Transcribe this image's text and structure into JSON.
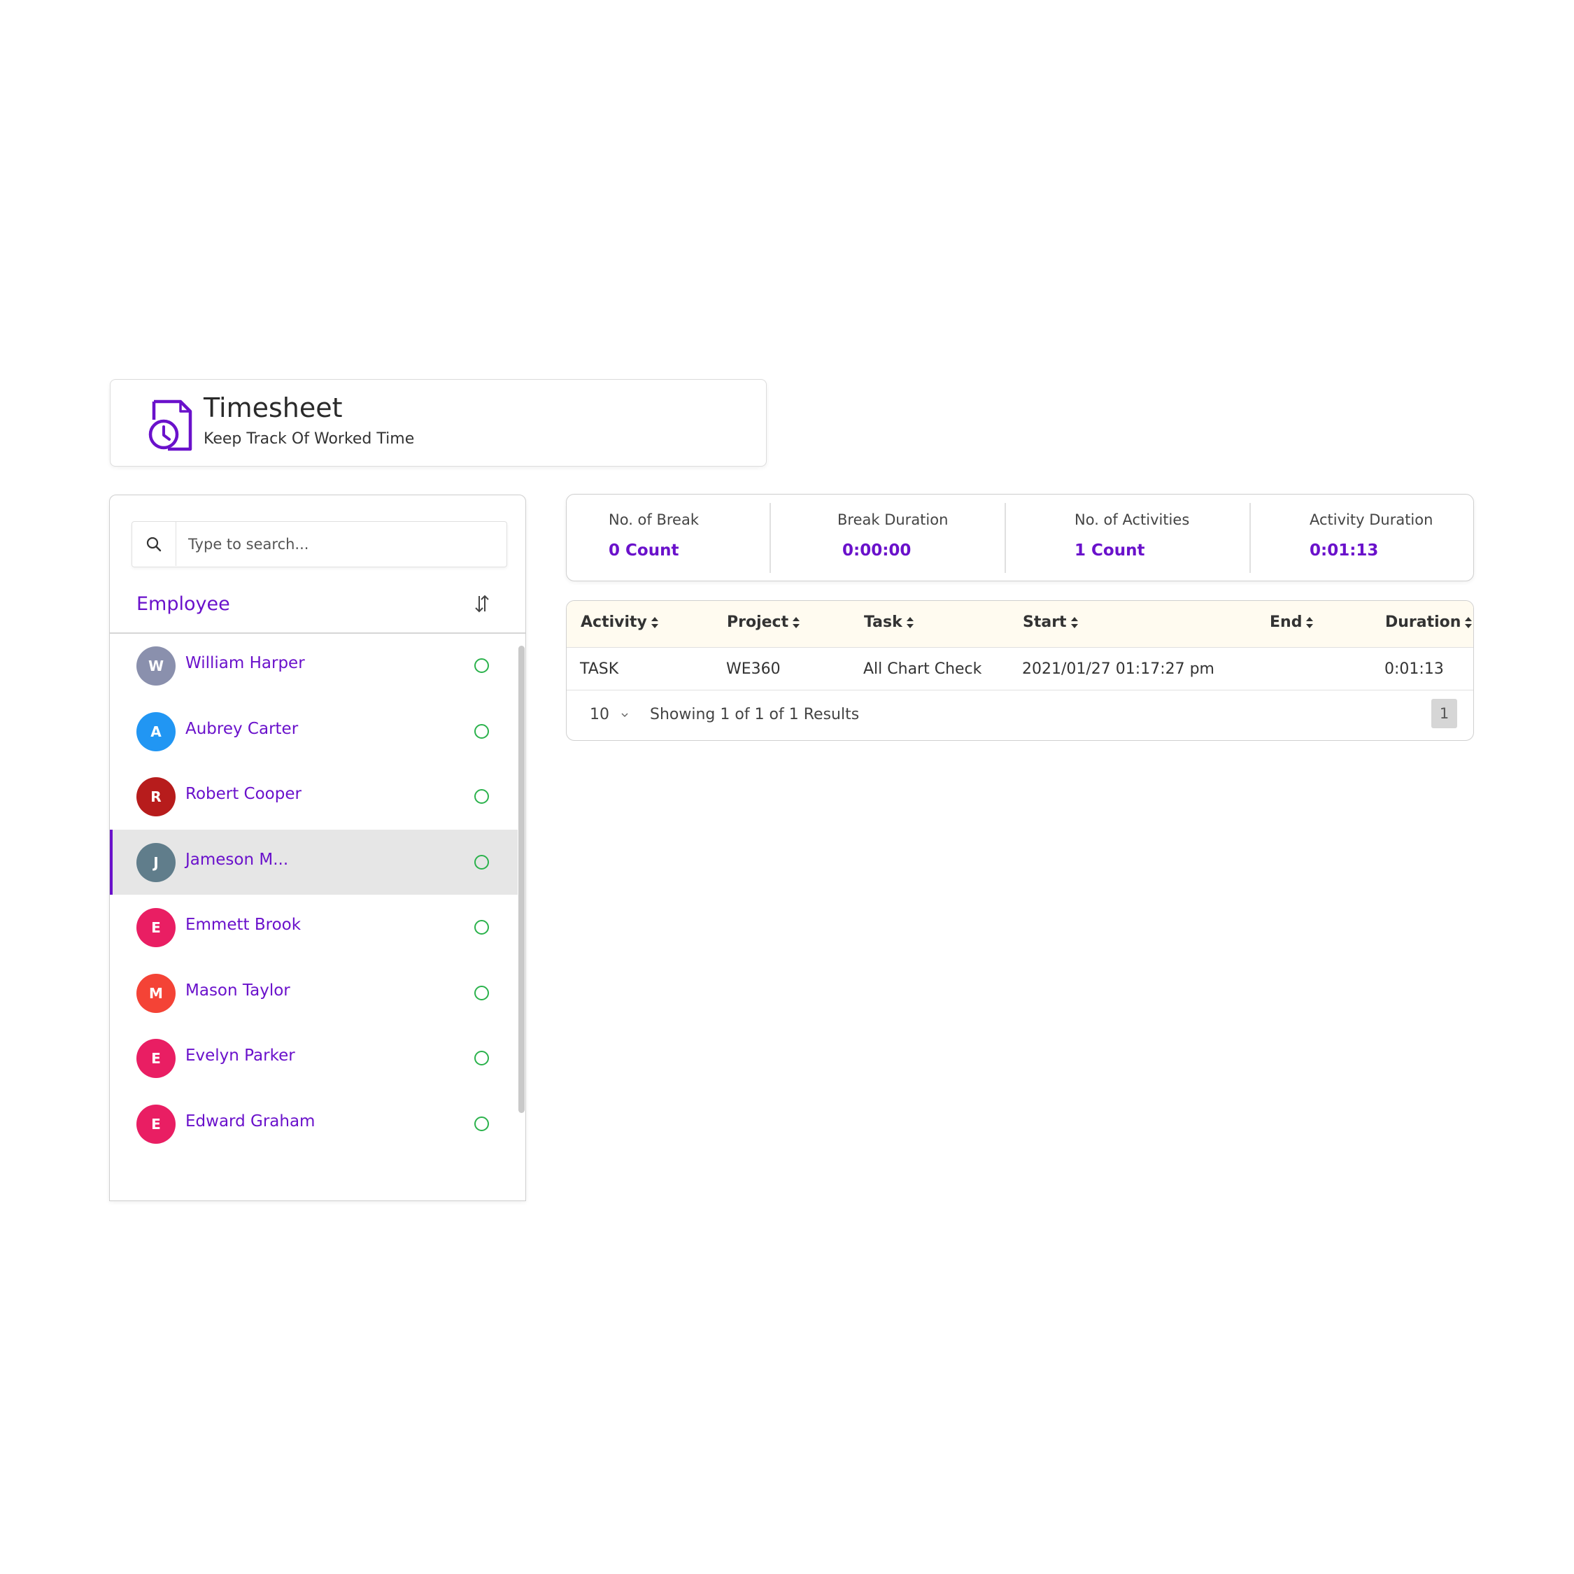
{
  "header": {
    "title": "Timesheet",
    "subtitle": "Keep Track Of Worked Time",
    "icon": "timesheet-clock-icon",
    "accent_color": "#6a11cb"
  },
  "sidebar": {
    "search": {
      "placeholder": "Type to search...",
      "value": ""
    },
    "heading": "Employee",
    "employees": [
      {
        "initial": "W",
        "name": "William Harper",
        "avatar_color": "#8a90ad",
        "status": "online",
        "selected": false
      },
      {
        "initial": "A",
        "name": "Aubrey Carter",
        "avatar_color": "#2196f3",
        "status": "online",
        "selected": false
      },
      {
        "initial": "R",
        "name": "Robert Cooper",
        "avatar_color": "#b71c1c",
        "status": "online",
        "selected": false
      },
      {
        "initial": "J",
        "name": "Jameson M...",
        "avatar_color": "#607d8b",
        "status": "online",
        "selected": true
      },
      {
        "initial": "E",
        "name": "Emmett Brook",
        "avatar_color": "#e91e63",
        "status": "online",
        "selected": false
      },
      {
        "initial": "M",
        "name": "Mason Taylor",
        "avatar_color": "#f44336",
        "status": "online",
        "selected": false
      },
      {
        "initial": "E",
        "name": "Evelyn Parker",
        "avatar_color": "#e91e63",
        "status": "online",
        "selected": false
      },
      {
        "initial": "E",
        "name": "Edward Graham",
        "avatar_color": "#e91e63",
        "status": "online",
        "selected": false
      }
    ]
  },
  "stats": [
    {
      "label": "No. of Break",
      "value": "0 Count"
    },
    {
      "label": "Break Duration",
      "value": "0:00:00"
    },
    {
      "label": "No. of Activities",
      "value": "1 Count"
    },
    {
      "label": "Activity Duration",
      "value": "0:01:13"
    }
  ],
  "table": {
    "columns": [
      "Activity",
      "Project",
      "Task",
      "Start",
      "End",
      "Duration"
    ],
    "rows": [
      [
        "TASK",
        "WE360",
        "All Chart Check",
        "2021/01/27 01:17:27 pm",
        "",
        "0:01:13"
      ]
    ],
    "page_size": "10",
    "results_text": "Showing 1 of 1 of 1 Results",
    "current_page": "1"
  }
}
